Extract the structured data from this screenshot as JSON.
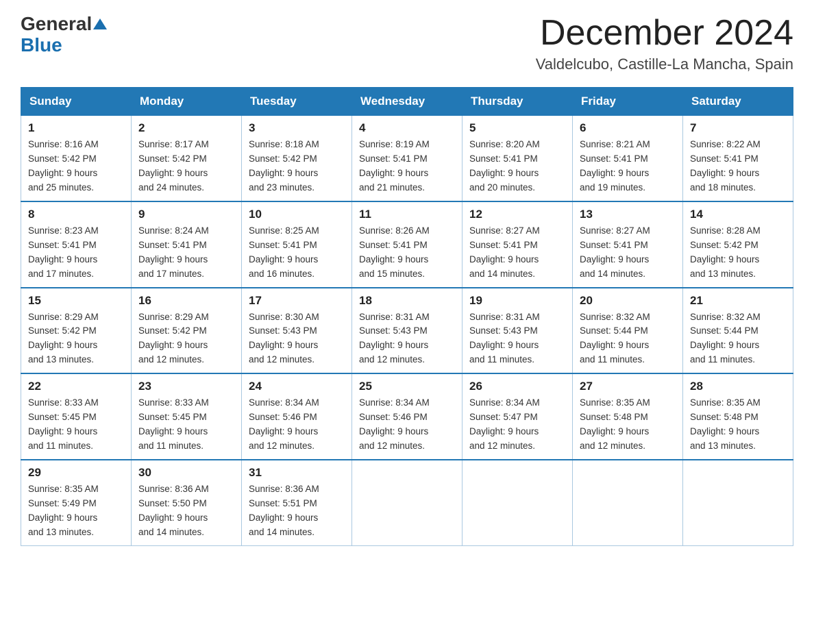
{
  "header": {
    "logo_general": "General",
    "logo_blue": "Blue",
    "month_title": "December 2024",
    "location": "Valdelcubo, Castille-La Mancha, Spain"
  },
  "days_of_week": [
    "Sunday",
    "Monday",
    "Tuesday",
    "Wednesday",
    "Thursday",
    "Friday",
    "Saturday"
  ],
  "weeks": [
    [
      {
        "day": "1",
        "sunrise": "8:16 AM",
        "sunset": "5:42 PM",
        "daylight_hours": "9 hours",
        "daylight_minutes": "and 25 minutes."
      },
      {
        "day": "2",
        "sunrise": "8:17 AM",
        "sunset": "5:42 PM",
        "daylight_hours": "9 hours",
        "daylight_minutes": "and 24 minutes."
      },
      {
        "day": "3",
        "sunrise": "8:18 AM",
        "sunset": "5:42 PM",
        "daylight_hours": "9 hours",
        "daylight_minutes": "and 23 minutes."
      },
      {
        "day": "4",
        "sunrise": "8:19 AM",
        "sunset": "5:41 PM",
        "daylight_hours": "9 hours",
        "daylight_minutes": "and 21 minutes."
      },
      {
        "day": "5",
        "sunrise": "8:20 AM",
        "sunset": "5:41 PM",
        "daylight_hours": "9 hours",
        "daylight_minutes": "and 20 minutes."
      },
      {
        "day": "6",
        "sunrise": "8:21 AM",
        "sunset": "5:41 PM",
        "daylight_hours": "9 hours",
        "daylight_minutes": "and 19 minutes."
      },
      {
        "day": "7",
        "sunrise": "8:22 AM",
        "sunset": "5:41 PM",
        "daylight_hours": "9 hours",
        "daylight_minutes": "and 18 minutes."
      }
    ],
    [
      {
        "day": "8",
        "sunrise": "8:23 AM",
        "sunset": "5:41 PM",
        "daylight_hours": "9 hours",
        "daylight_minutes": "and 17 minutes."
      },
      {
        "day": "9",
        "sunrise": "8:24 AM",
        "sunset": "5:41 PM",
        "daylight_hours": "9 hours",
        "daylight_minutes": "and 17 minutes."
      },
      {
        "day": "10",
        "sunrise": "8:25 AM",
        "sunset": "5:41 PM",
        "daylight_hours": "9 hours",
        "daylight_minutes": "and 16 minutes."
      },
      {
        "day": "11",
        "sunrise": "8:26 AM",
        "sunset": "5:41 PM",
        "daylight_hours": "9 hours",
        "daylight_minutes": "and 15 minutes."
      },
      {
        "day": "12",
        "sunrise": "8:27 AM",
        "sunset": "5:41 PM",
        "daylight_hours": "9 hours",
        "daylight_minutes": "and 14 minutes."
      },
      {
        "day": "13",
        "sunrise": "8:27 AM",
        "sunset": "5:41 PM",
        "daylight_hours": "9 hours",
        "daylight_minutes": "and 14 minutes."
      },
      {
        "day": "14",
        "sunrise": "8:28 AM",
        "sunset": "5:42 PM",
        "daylight_hours": "9 hours",
        "daylight_minutes": "and 13 minutes."
      }
    ],
    [
      {
        "day": "15",
        "sunrise": "8:29 AM",
        "sunset": "5:42 PM",
        "daylight_hours": "9 hours",
        "daylight_minutes": "and 13 minutes."
      },
      {
        "day": "16",
        "sunrise": "8:29 AM",
        "sunset": "5:42 PM",
        "daylight_hours": "9 hours",
        "daylight_minutes": "and 12 minutes."
      },
      {
        "day": "17",
        "sunrise": "8:30 AM",
        "sunset": "5:43 PM",
        "daylight_hours": "9 hours",
        "daylight_minutes": "and 12 minutes."
      },
      {
        "day": "18",
        "sunrise": "8:31 AM",
        "sunset": "5:43 PM",
        "daylight_hours": "9 hours",
        "daylight_minutes": "and 12 minutes."
      },
      {
        "day": "19",
        "sunrise": "8:31 AM",
        "sunset": "5:43 PM",
        "daylight_hours": "9 hours",
        "daylight_minutes": "and 11 minutes."
      },
      {
        "day": "20",
        "sunrise": "8:32 AM",
        "sunset": "5:44 PM",
        "daylight_hours": "9 hours",
        "daylight_minutes": "and 11 minutes."
      },
      {
        "day": "21",
        "sunrise": "8:32 AM",
        "sunset": "5:44 PM",
        "daylight_hours": "9 hours",
        "daylight_minutes": "and 11 minutes."
      }
    ],
    [
      {
        "day": "22",
        "sunrise": "8:33 AM",
        "sunset": "5:45 PM",
        "daylight_hours": "9 hours",
        "daylight_minutes": "and 11 minutes."
      },
      {
        "day": "23",
        "sunrise": "8:33 AM",
        "sunset": "5:45 PM",
        "daylight_hours": "9 hours",
        "daylight_minutes": "and 11 minutes."
      },
      {
        "day": "24",
        "sunrise": "8:34 AM",
        "sunset": "5:46 PM",
        "daylight_hours": "9 hours",
        "daylight_minutes": "and 12 minutes."
      },
      {
        "day": "25",
        "sunrise": "8:34 AM",
        "sunset": "5:46 PM",
        "daylight_hours": "9 hours",
        "daylight_minutes": "and 12 minutes."
      },
      {
        "day": "26",
        "sunrise": "8:34 AM",
        "sunset": "5:47 PM",
        "daylight_hours": "9 hours",
        "daylight_minutes": "and 12 minutes."
      },
      {
        "day": "27",
        "sunrise": "8:35 AM",
        "sunset": "5:48 PM",
        "daylight_hours": "9 hours",
        "daylight_minutes": "and 12 minutes."
      },
      {
        "day": "28",
        "sunrise": "8:35 AM",
        "sunset": "5:48 PM",
        "daylight_hours": "9 hours",
        "daylight_minutes": "and 13 minutes."
      }
    ],
    [
      {
        "day": "29",
        "sunrise": "8:35 AM",
        "sunset": "5:49 PM",
        "daylight_hours": "9 hours",
        "daylight_minutes": "and 13 minutes."
      },
      {
        "day": "30",
        "sunrise": "8:36 AM",
        "sunset": "5:50 PM",
        "daylight_hours": "9 hours",
        "daylight_minutes": "and 14 minutes."
      },
      {
        "day": "31",
        "sunrise": "8:36 AM",
        "sunset": "5:51 PM",
        "daylight_hours": "9 hours",
        "daylight_minutes": "and 14 minutes."
      },
      null,
      null,
      null,
      null
    ]
  ]
}
